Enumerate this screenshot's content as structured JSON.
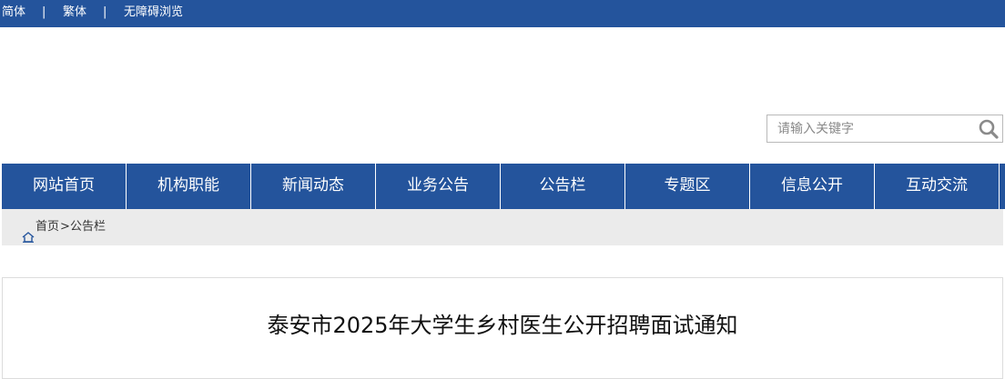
{
  "topbar": {
    "simplified": "简体",
    "divider1": "|",
    "traditional": "繁体",
    "divider2": "|",
    "accessibility": "无障碍浏览"
  },
  "search": {
    "placeholder": "请输入关键字",
    "icon": "search-icon"
  },
  "nav": {
    "items": [
      {
        "label": "网站首页"
      },
      {
        "label": "机构职能"
      },
      {
        "label": "新闻动态"
      },
      {
        "label": "业务公告"
      },
      {
        "label": "公告栏"
      },
      {
        "label": "专题区"
      },
      {
        "label": "信息公开"
      },
      {
        "label": "互动交流"
      }
    ]
  },
  "breadcrumb": {
    "icon": "home-icon",
    "home": "首页",
    "separator": ">",
    "current": "公告栏"
  },
  "article": {
    "title": "泰安市2025年大学生乡村医生公开招聘面试通知"
  },
  "colors": {
    "primary": "#24549c",
    "breadcrumb_bg": "#ebebeb"
  }
}
